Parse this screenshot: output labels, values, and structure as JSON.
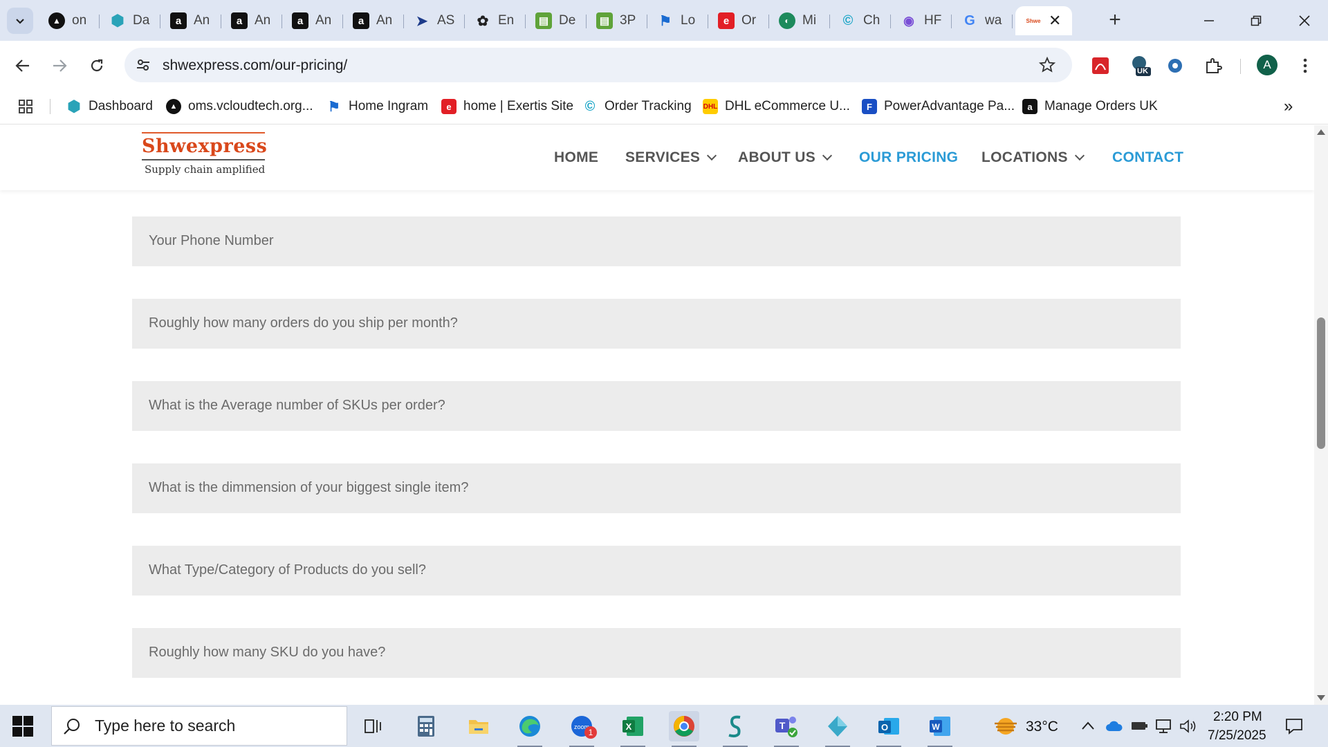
{
  "browser": {
    "tabs": [
      {
        "label": "on",
        "icon": "black-circle-icon"
      },
      {
        "label": "Da",
        "icon": "hexagon-icon"
      },
      {
        "label": "An",
        "icon": "amazon-icon"
      },
      {
        "label": "An",
        "icon": "amazon-icon"
      },
      {
        "label": "An",
        "icon": "amazon-icon"
      },
      {
        "label": "An",
        "icon": "amazon-icon"
      },
      {
        "label": "AS",
        "icon": "play-arrow-icon"
      },
      {
        "label": "En",
        "icon": "openai-icon"
      },
      {
        "label": "De",
        "icon": "green-app-icon"
      },
      {
        "label": "3P",
        "icon": "green-app-icon"
      },
      {
        "label": "Lo",
        "icon": "blue-flag-icon"
      },
      {
        "label": "Or",
        "icon": "exertis-icon"
      },
      {
        "label": "Mi",
        "icon": "green-circle-icon"
      },
      {
        "label": "Ch",
        "icon": "teal-c-icon"
      },
      {
        "label": "HF",
        "icon": "purple-chart-icon"
      },
      {
        "label": "wa",
        "icon": "google-icon"
      }
    ],
    "active_tab": {
      "label": "Shwe",
      "icon": "shwexpress-favicon"
    },
    "url": "shwexpress.com/our-pricing/",
    "profile_initial": "A",
    "bookmarks": [
      {
        "label": "Dashboard",
        "icon": "hexagon-icon"
      },
      {
        "label": "oms.vcloudtech.org...",
        "icon": "black-circle-icon"
      },
      {
        "label": "Home Ingram",
        "icon": "blue-flag-icon"
      },
      {
        "label": "home | Exertis Site",
        "icon": "exertis-icon"
      },
      {
        "label": "Order Tracking",
        "icon": "teal-c-icon"
      },
      {
        "label": "DHL eCommerce U...",
        "icon": "dhl-icon"
      },
      {
        "label": "PowerAdvantage Pa...",
        "icon": "blue-doc-icon"
      },
      {
        "label": "Manage Orders UK",
        "icon": "amazon-icon"
      }
    ],
    "ext_badge": "UK"
  },
  "site": {
    "logo_name": "Shwexpress",
    "logo_tagline": "Supply chain amplified",
    "menu": [
      {
        "label": "HOME",
        "dropdown": false,
        "highlight": false
      },
      {
        "label": "SERVICES",
        "dropdown": true,
        "highlight": false
      },
      {
        "label": "ABOUT US",
        "dropdown": true,
        "highlight": false
      },
      {
        "label": "OUR PRICING",
        "dropdown": false,
        "highlight": true
      },
      {
        "label": "LOCATIONS",
        "dropdown": true,
        "highlight": false
      },
      {
        "label": "CONTACT",
        "dropdown": false,
        "highlight": true
      }
    ],
    "accent_color": "#2b9bd6",
    "brand_color": "#d9481b"
  },
  "form": {
    "fields": [
      {
        "placeholder": "Your Phone Number",
        "value": ""
      },
      {
        "placeholder": "Roughly how many orders do you ship per month?",
        "value": ""
      },
      {
        "placeholder": "What is the Average number of SKUs per order?",
        "value": ""
      },
      {
        "placeholder": "What is the dimmension of your biggest single item?",
        "value": ""
      },
      {
        "placeholder": "What Type/Category of Products do you sell?",
        "value": ""
      },
      {
        "placeholder": "Roughly how many SKU do you have?",
        "value": ""
      }
    ]
  },
  "taskbar": {
    "search_placeholder": "Type here to search",
    "weather": "33°C",
    "time": "2:20 PM",
    "date": "7/25/2025",
    "zoom_badge": "1",
    "apps": [
      "task-view-icon",
      "calculator-icon",
      "file-explorer-icon",
      "edge-icon",
      "zoom-icon",
      "excel-icon",
      "chrome-icon",
      "sway-icon",
      "teams-icon",
      "app-diamond-icon",
      "outlook-icon",
      "word-icon"
    ]
  }
}
